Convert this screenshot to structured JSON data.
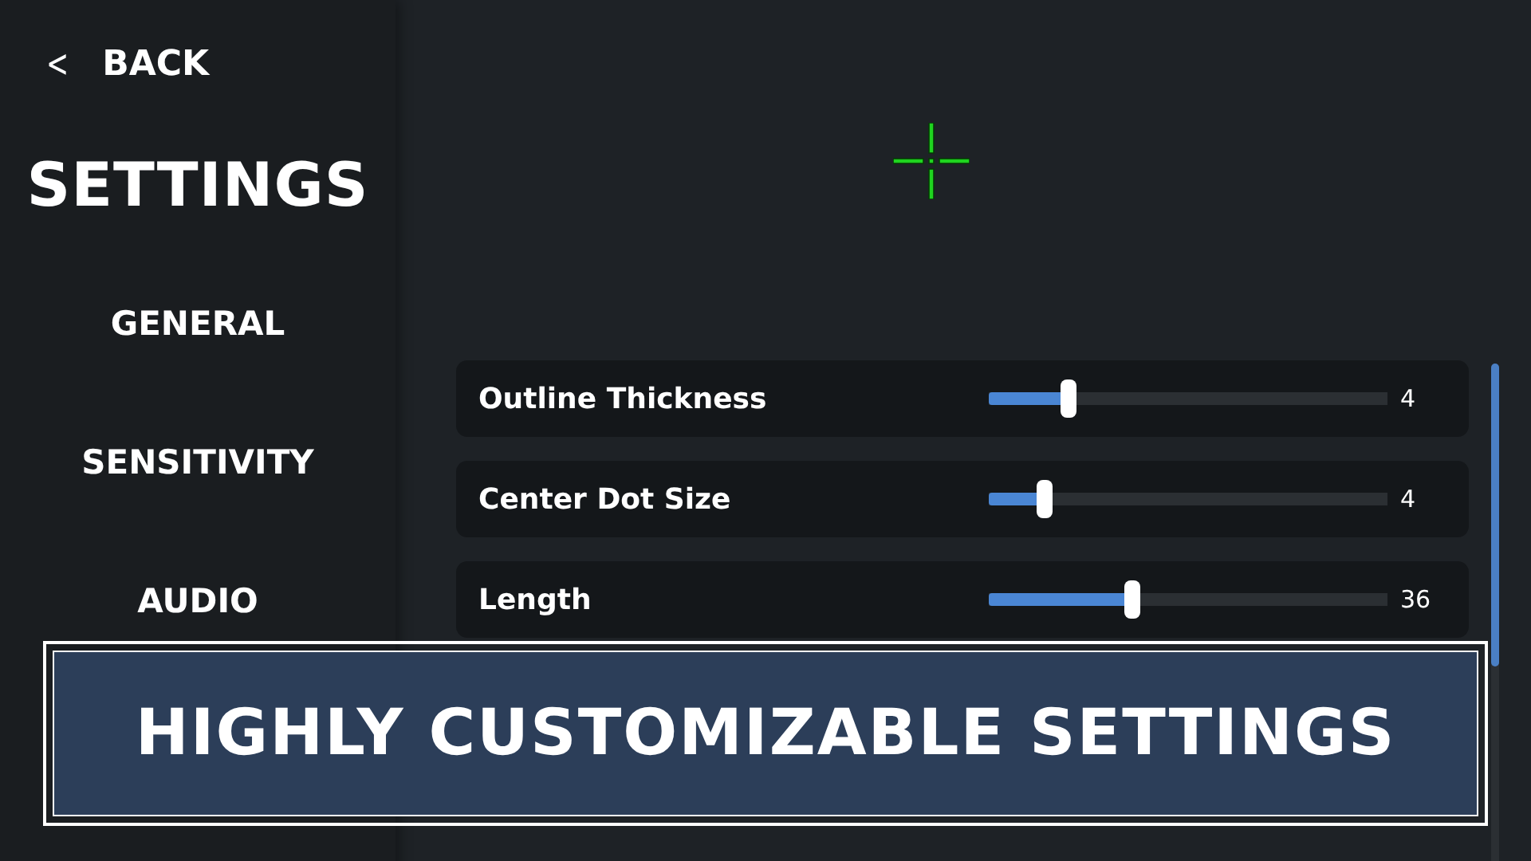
{
  "sidebar": {
    "back": {
      "icon": "<",
      "label": "BACK"
    },
    "title": "SETTINGS",
    "items": [
      {
        "label": "GENERAL"
      },
      {
        "label": "SENSITIVITY"
      },
      {
        "label": "AUDIO"
      }
    ]
  },
  "settings": [
    {
      "label": "Outline Thickness",
      "level": 0.2,
      "reading": "4"
    },
    {
      "label": "Center Dot Size",
      "level": 0.14,
      "reading": "4"
    },
    {
      "label": "Length",
      "level": 0.36,
      "reading": "36"
    }
  ],
  "banner": {
    "text": "HIGHLY CUSTOMIZABLE SETTINGS"
  }
}
